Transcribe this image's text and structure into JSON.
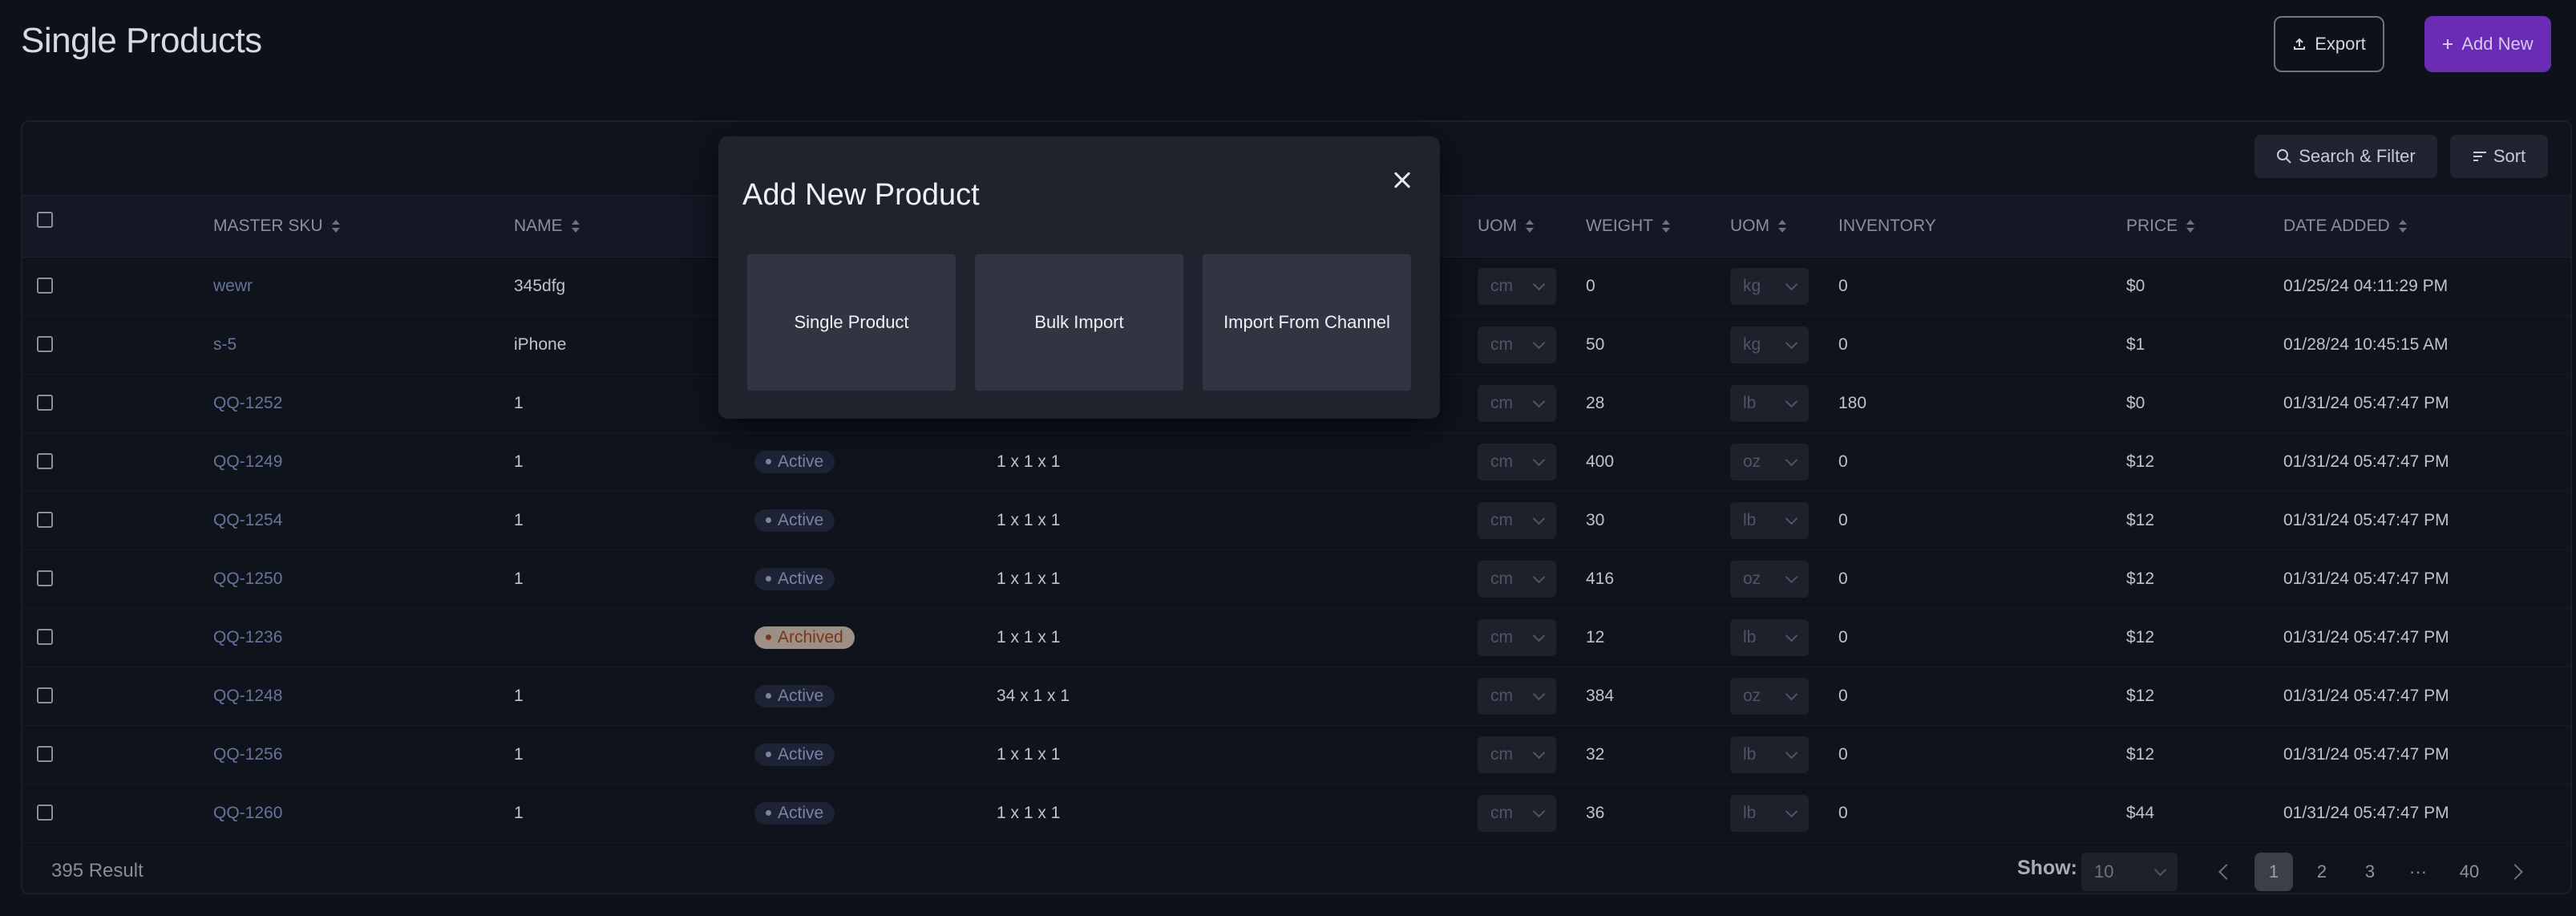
{
  "page": {
    "title": "Single Products"
  },
  "toolbar": {
    "export_label": "Export",
    "add_new_label": "Add New",
    "search_filter_label": "Search & Filter",
    "sort_label": "Sort"
  },
  "table": {
    "columns": [
      {
        "label": "MASTER SKU",
        "sortable": true
      },
      {
        "label": "NAME",
        "sortable": true
      },
      {
        "label": "UOM",
        "sortable": true
      },
      {
        "label": "WEIGHT",
        "sortable": true
      },
      {
        "label": "UOM",
        "sortable": true
      },
      {
        "label": "INVENTORY",
        "sortable": false
      },
      {
        "label": "PRICE",
        "sortable": true
      },
      {
        "label": "DATE ADDED",
        "sortable": true
      }
    ],
    "rows": [
      {
        "sku": "wewr",
        "name": "345dfg",
        "status": "",
        "dims": "",
        "dim_uom": "cm",
        "weight": "0",
        "weight_uom": "kg",
        "inventory": "0",
        "price": "$0",
        "date": "01/25/24 04:11:29 PM"
      },
      {
        "sku": "s-5",
        "name": "iPhone",
        "status": "",
        "dims": "",
        "dim_uom": "cm",
        "weight": "50",
        "weight_uom": "kg",
        "inventory": "0",
        "price": "$1",
        "date": "01/28/24 10:45:15 AM"
      },
      {
        "sku": "QQ-1252",
        "name": "1",
        "status": "",
        "dims": "",
        "dim_uom": "cm",
        "weight": "28",
        "weight_uom": "lb",
        "inventory": "180",
        "price": "$0",
        "date": "01/31/24 05:47:47 PM"
      },
      {
        "sku": "QQ-1249",
        "name": "1",
        "status": "Active",
        "dims": "1 x 1 x 1",
        "dim_uom": "cm",
        "weight": "400",
        "weight_uom": "oz",
        "inventory": "0",
        "price": "$12",
        "date": "01/31/24 05:47:47 PM"
      },
      {
        "sku": "QQ-1254",
        "name": "1",
        "status": "Active",
        "dims": "1 x 1 x 1",
        "dim_uom": "cm",
        "weight": "30",
        "weight_uom": "lb",
        "inventory": "0",
        "price": "$12",
        "date": "01/31/24 05:47:47 PM"
      },
      {
        "sku": "QQ-1250",
        "name": "1",
        "status": "Active",
        "dims": "1 x 1 x 1",
        "dim_uom": "cm",
        "weight": "416",
        "weight_uom": "oz",
        "inventory": "0",
        "price": "$12",
        "date": "01/31/24 05:47:47 PM"
      },
      {
        "sku": "QQ-1236",
        "name": "",
        "status": "Archived",
        "dims": "1 x 1 x 1",
        "dim_uom": "cm",
        "weight": "12",
        "weight_uom": "lb",
        "inventory": "0",
        "price": "$12",
        "date": "01/31/24 05:47:47 PM"
      },
      {
        "sku": "QQ-1248",
        "name": "1",
        "status": "Active",
        "dims": "34 x 1 x 1",
        "dim_uom": "cm",
        "weight": "384",
        "weight_uom": "oz",
        "inventory": "0",
        "price": "$12",
        "date": "01/31/24 05:47:47 PM"
      },
      {
        "sku": "QQ-1256",
        "name": "1",
        "status": "Active",
        "dims": "1 x 1 x 1",
        "dim_uom": "cm",
        "weight": "32",
        "weight_uom": "lb",
        "inventory": "0",
        "price": "$12",
        "date": "01/31/24 05:47:47 PM"
      },
      {
        "sku": "QQ-1260",
        "name": "1",
        "status": "Active",
        "dims": "1 x 1 x 1",
        "dim_uom": "cm",
        "weight": "36",
        "weight_uom": "lb",
        "inventory": "0",
        "price": "$44",
        "date": "01/31/24 05:47:47 PM"
      }
    ]
  },
  "footer": {
    "result_count": "395 Result",
    "show_label": "Show:",
    "page_size": "10",
    "pages": [
      "1",
      "2",
      "3",
      "···",
      "40"
    ],
    "current_page": "1"
  },
  "modal": {
    "title": "Add New Product",
    "options": [
      "Single Product",
      "Bulk Import",
      "Import From Channel"
    ]
  },
  "colors": {
    "background": "#0d111a",
    "accent": "#6a2cb4",
    "modal_bg": "#20232d",
    "active_badge_bg": "#1d2335",
    "archived_badge_bg": "#9b8f86"
  },
  "icons": {
    "export": "upload-icon",
    "add_new": "plus-icon",
    "search": "search-icon",
    "sort": "sort-lines-icon",
    "close": "close-icon"
  }
}
